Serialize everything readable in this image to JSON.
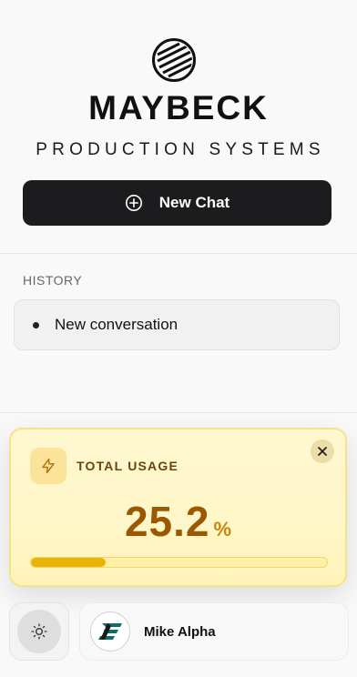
{
  "brand": {
    "name": "MAYBECK",
    "subtitle": "PRODUCTION SYSTEMS",
    "logo_icon": "striped-circle-logo"
  },
  "new_chat": {
    "label": "New Chat",
    "icon": "plus-circle-icon"
  },
  "history": {
    "title": "HISTORY",
    "items": [
      {
        "label": "New conversation"
      }
    ]
  },
  "usage": {
    "title": "TOTAL USAGE",
    "value": "25.2",
    "unit": "%",
    "progress_percent": 25.2,
    "icon": "lightning-icon",
    "close_icon": "close-icon",
    "colors": {
      "accent": "#eab308",
      "value_text": "#9a5900",
      "title_text": "#6b4310"
    }
  },
  "footer": {
    "theme_icon": "sun-icon",
    "user": {
      "name": "Mike Alpha",
      "avatar_icon": "company-logo-avatar"
    }
  }
}
